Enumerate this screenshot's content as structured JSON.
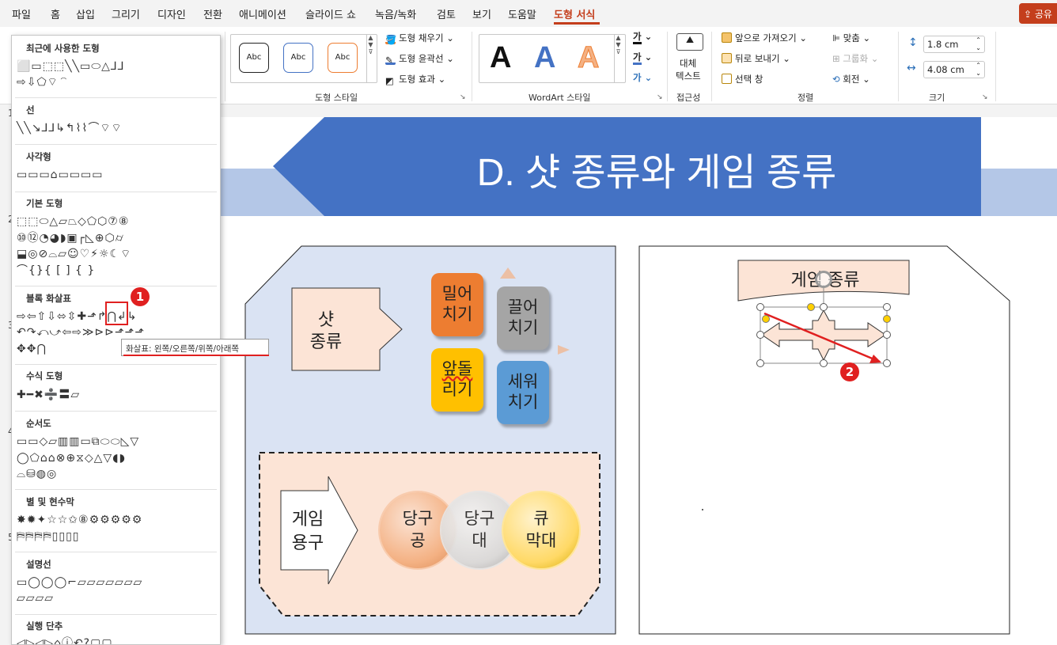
{
  "menu": {
    "tabs": [
      "파일",
      "홈",
      "삽입",
      "그리기",
      "디자인",
      "전환",
      "애니메이션",
      "슬라이드 쇼",
      "녹음/녹화",
      "검토",
      "보기",
      "도움말",
      "도형 서식"
    ],
    "active_tab": "도형 서식",
    "share": "공유"
  },
  "ribbon": {
    "shape_styles": {
      "label": "도형 스타일",
      "sample": "Abc",
      "fill": "도형 채우기",
      "outline": "도형 윤곽선",
      "effects": "도형 효과"
    },
    "wordart": {
      "label": "WordArt 스타일",
      "sample": "A"
    },
    "accessibility": {
      "label": "접근성",
      "alt_text_line1": "대체",
      "alt_text_line2": "텍스트"
    },
    "arrange": {
      "label": "정렬",
      "bring_forward": "앞으로 가져오기",
      "send_backward": "뒤로 보내기",
      "selection_pane": "선택 창",
      "align": "맞춤",
      "group": "그룹화",
      "rotate": "회전"
    },
    "size": {
      "label": "크기",
      "height": "1.8 cm",
      "width": "4.08 cm"
    }
  },
  "shape_panel": {
    "sections": [
      {
        "title": "최근에 사용한 도형",
        "rows": [
          "⬜▭⬚⬚╲╲▭⬭△⅃⅃",
          "⇨⇩⬠⌔⌒"
        ]
      },
      {
        "title": "선",
        "rows": [
          "╲╲↘⅃⅃↳↰⌇⌇⌒⌔⌔"
        ]
      },
      {
        "title": "사각형",
        "rows": [
          "▭▭▭⌂▭▭▭▭"
        ]
      },
      {
        "title": "기본 도형",
        "rows": [
          "⬚⬚⬭△▱⏢◇⬠⬡⑦⑧",
          "⑩⑫◔◕◗▣┌◺⊕⬡⌭",
          "⬓◎⊘⌓▱☺♡⚡☼☾⌔",
          "⌒{}{ [ ] { }"
        ]
      },
      {
        "title": "블록 화살표",
        "rows": [
          "⇨⇦⇧⇩⬄⇳✚⬏↱⋂↲↳",
          "↶↷⤺⤻⇦⇨≫⊳⊳⬏⬏⬏",
          "✥✥⋂"
        ]
      },
      {
        "title": "수식 도형",
        "rows": [
          "✚━✖➗〓▱"
        ]
      },
      {
        "title": "순서도",
        "rows": [
          "▭▭◇▱▥▥▭⧉⬭⬭◺▽",
          "◯⬠⌂⌂⊗⊕⧖◇△▽◖◗",
          "⌓⛁◍◎"
        ]
      },
      {
        "title": "별 및 현수막",
        "rows": [
          "✸✹✦☆☆✩⑧⚙⚙⚙⚙⚙",
          "⛿⛿⛿⛿▯▯▯▯"
        ]
      },
      {
        "title": "설명선",
        "rows": [
          "▭◯◯◯⌐▱▱▱▱▱▱▱",
          "▱▱▱▱"
        ]
      },
      {
        "title": "실행 단추",
        "rows": [
          "◁▷◁▷⌂ⓘ↶?▢▢"
        ]
      }
    ],
    "tooltip": "화살표: 왼쪽/오른쪽/위쪽/아래쪽",
    "badge1": "1"
  },
  "gutter_numbers": [
    "1",
    "2",
    "3",
    "4",
    "5"
  ],
  "slide": {
    "title": "D. 샷 종류와 게임 종류",
    "shot_arrow": {
      "line1": "샷",
      "line2": "종류"
    },
    "cubes": [
      {
        "line1": "밀어",
        "line2": "치기",
        "color": "#ed7d31"
      },
      {
        "line1": "끌어",
        "line2": "치기",
        "color": "#a5a5a5"
      },
      {
        "line1": "앞돌",
        "line2": "리기",
        "color": "#ffc000"
      },
      {
        "line1": "세워",
        "line2": "치기",
        "color": "#5b9bd5"
      }
    ],
    "equipment_arrow": {
      "line1": "게임",
      "line2": "용구"
    },
    "balls": [
      {
        "line1": "당구",
        "line2": "공",
        "color": "#f4b183"
      },
      {
        "line1": "당구",
        "line2": "대",
        "color": "#d9d9d9"
      },
      {
        "line1": "큐",
        "line2": "막대",
        "color": "#ffd966"
      }
    ],
    "game_title": "게임 종류",
    "badge2": "2"
  }
}
